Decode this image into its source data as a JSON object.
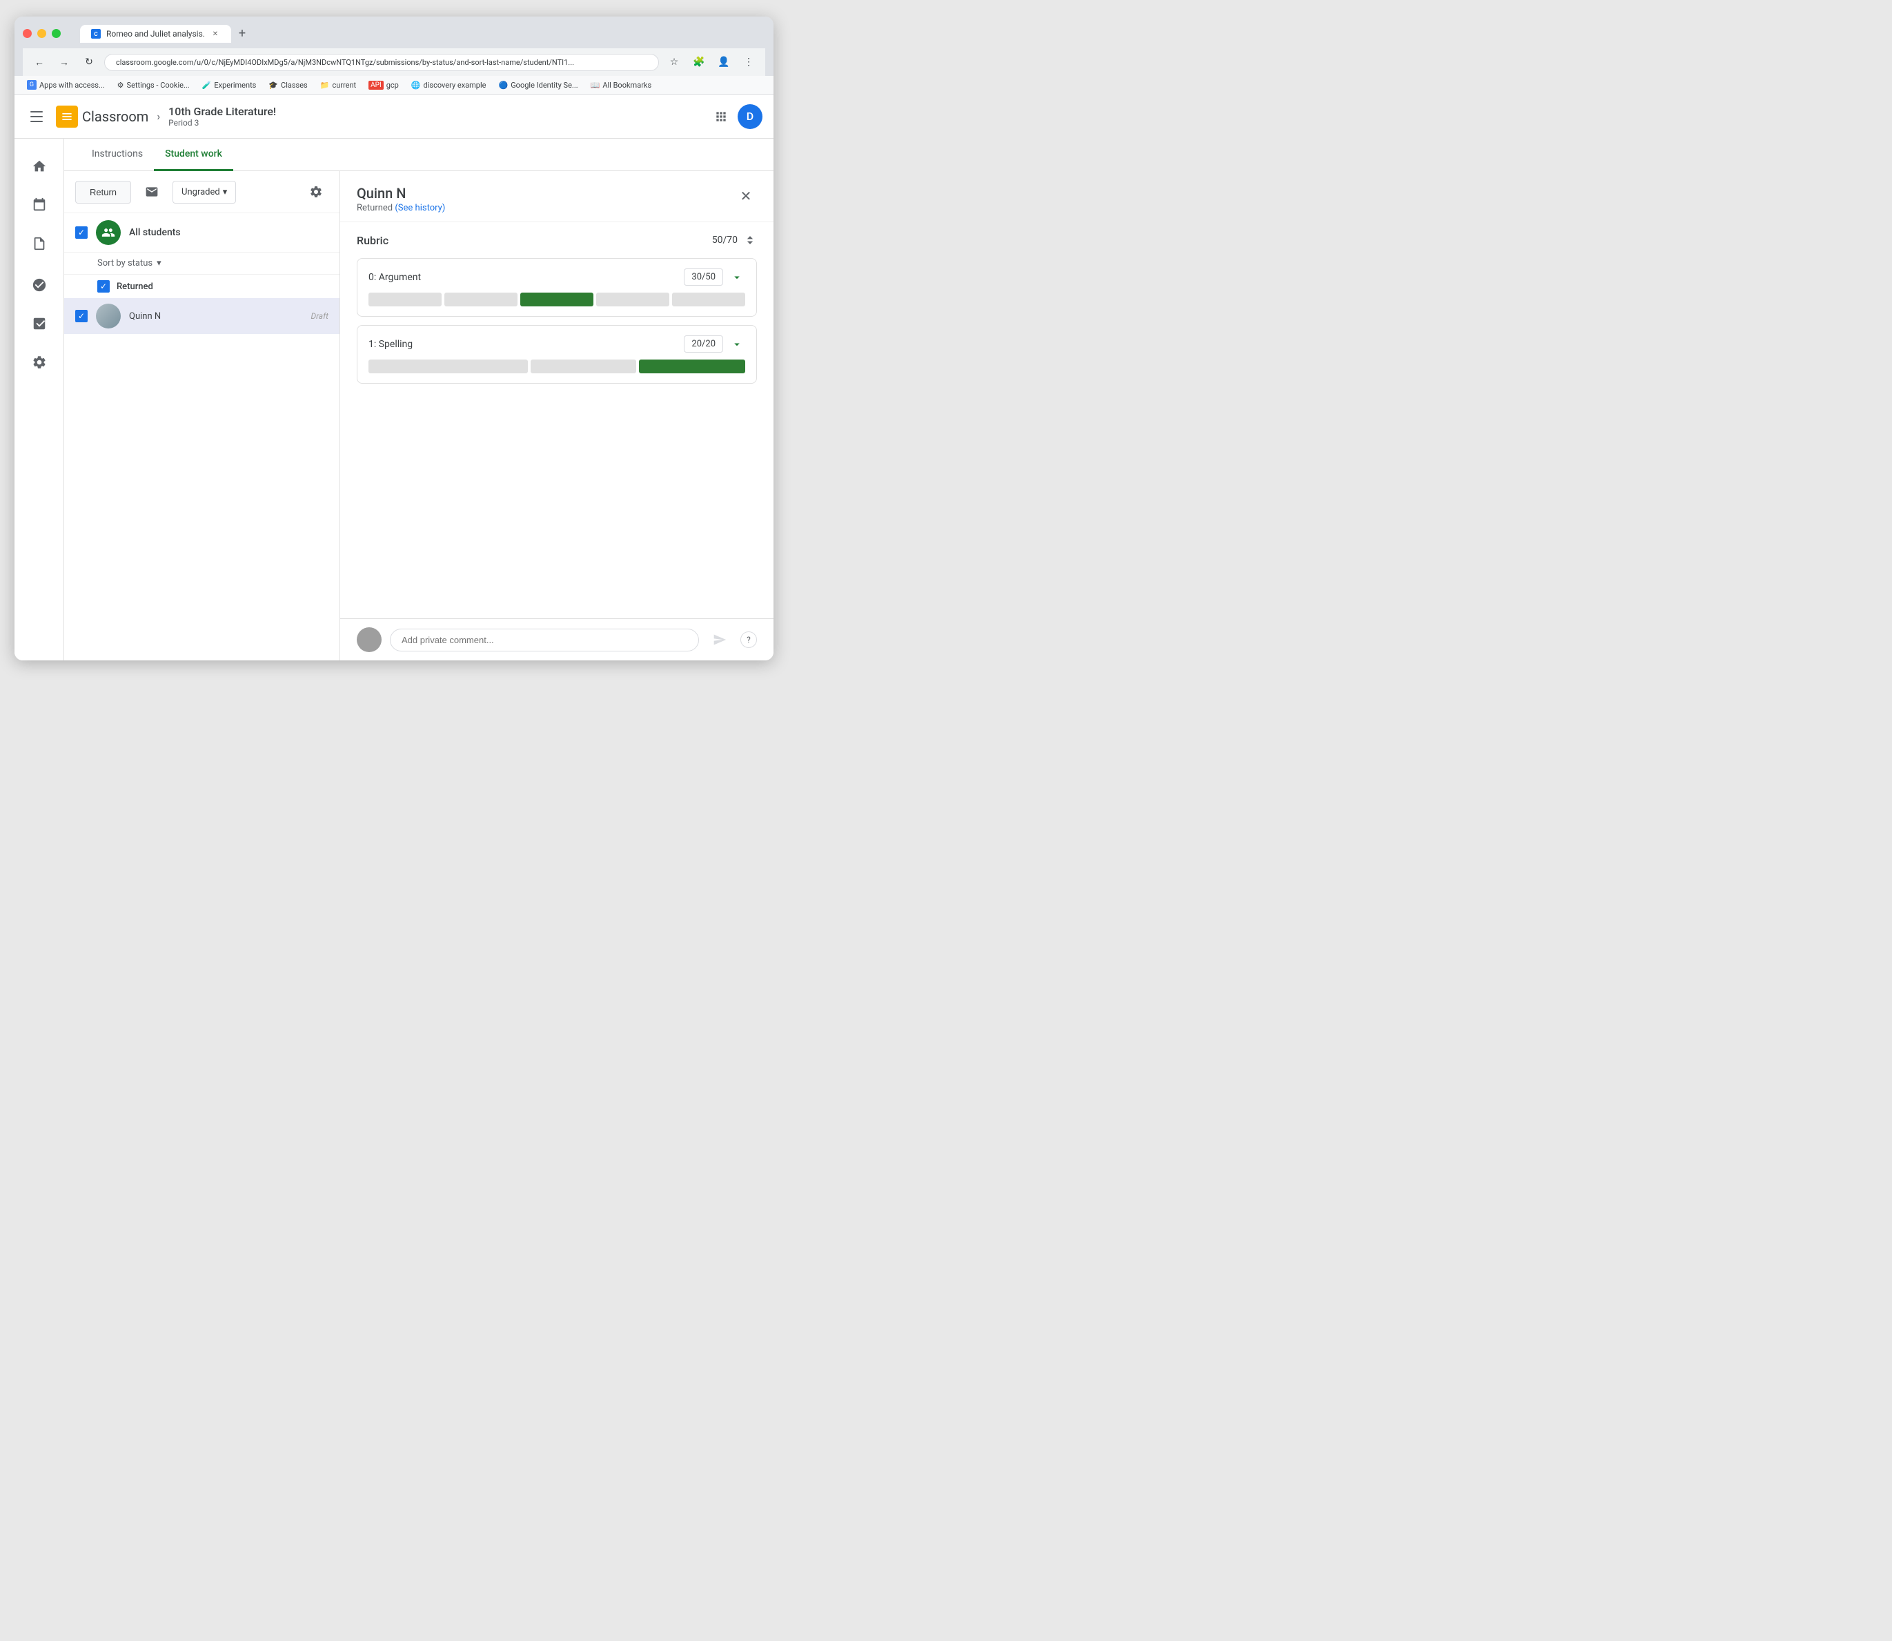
{
  "browser": {
    "tab_title": "Romeo and Juliet analysis.",
    "url": "classroom.google.com/u/0/c/NjEyMDI4ODIxMDg5/a/NjM3NDcwNTQ1NTgz/submissions/by-status/and-sort-last-name/student/NTI1...",
    "new_tab_label": "+",
    "bookmarks": [
      {
        "label": "Apps with access...",
        "icon": "G"
      },
      {
        "label": "Settings - Cookie...",
        "icon": "⚙"
      },
      {
        "label": "Experiments",
        "icon": "🧪"
      },
      {
        "label": "Classes",
        "icon": "🎓"
      },
      {
        "label": "current",
        "icon": "📁"
      },
      {
        "label": "gcp",
        "icon": "⚡"
      },
      {
        "label": "discovery example",
        "icon": "🌐"
      },
      {
        "label": "Google Identity Se...",
        "icon": "🔵"
      },
      {
        "label": "All Bookmarks",
        "icon": "📖"
      }
    ]
  },
  "header": {
    "app_name": "Classroom",
    "course_title": "10th Grade Literature!",
    "course_period": "Period 3",
    "user_initial": "D"
  },
  "tabs": {
    "instructions_label": "Instructions",
    "student_work_label": "Student work"
  },
  "panel_toolbar": {
    "return_label": "Return",
    "grade_filter": "Ungraded",
    "settings_tooltip": "Settings"
  },
  "student_list": {
    "all_students_label": "All students",
    "sort_label": "Sort by status",
    "section_returned": "Returned",
    "student_name": "Quinn N",
    "student_status": "Draft"
  },
  "detail": {
    "student_name": "Quinn N",
    "status_text": "Returned ",
    "see_history_text": "(See history)",
    "rubric_title": "Rubric",
    "rubric_total_score": "50/70",
    "criteria": [
      {
        "title": "0: Argument",
        "score": "30/50",
        "segments": [
          {
            "filled": false
          },
          {
            "filled": false
          },
          {
            "filled": true
          },
          {
            "filled": false
          },
          {
            "filled": false
          }
        ]
      },
      {
        "title": "1: Spelling",
        "score": "20/20",
        "segments": [
          {
            "filled": false
          },
          {
            "filled": false
          },
          {
            "filled": true
          }
        ]
      }
    ]
  },
  "comment": {
    "placeholder": "Add private comment..."
  }
}
